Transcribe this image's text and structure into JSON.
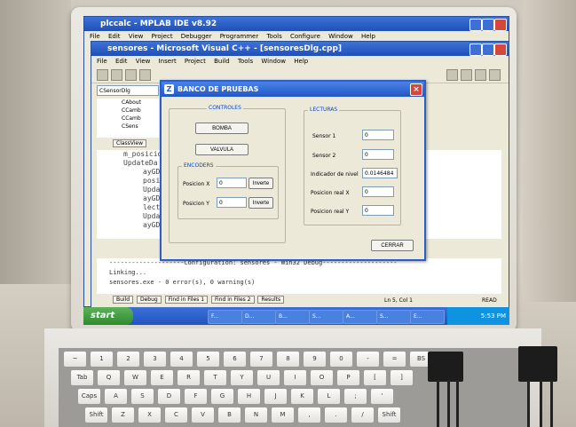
{
  "desktop": {
    "mplab_title": "plccalc - MPLAB IDE v8.92",
    "mplab_menu": [
      "File",
      "Edit",
      "View",
      "Project",
      "Debugger",
      "Programmer",
      "Tools",
      "Configure",
      "Window",
      "Help"
    ],
    "vc_title": "sensores - Microsoft Visual C++ - [sensoresDlg.cpp]",
    "vc_menu": [
      "File",
      "Edit",
      "View",
      "Insert",
      "Project",
      "Build",
      "Tools",
      "Window",
      "Help"
    ],
    "class_combo": "CSensorDlg",
    "tree_items": [
      "CAbout",
      "CCamb",
      "CCamb",
      "CSens"
    ],
    "classview_tab": "ClassView",
    "code_lines": [
      "m_posicion",
      "UpdateDa",
      "ayGD",
      "posi",
      "Upda",
      "ayGD",
      "lect",
      "Upda",
      "ayGD"
    ],
    "output_lines": [
      "Linking...",
      "sensores.exe - 0 error(s), 0 warning(s)"
    ],
    "config_line": "--------------------Configuration: sensores - Win32 Debug--------------------",
    "output_tabs": [
      "Build",
      "Debug",
      "Find in Files 1",
      "Find in Files 2",
      "Results"
    ],
    "status_text": "Ln 5, Col 1",
    "status_read": "READ",
    "start_label": "start",
    "taskbar_items": [
      "F...",
      "D...",
      "B...",
      "S...",
      "A...",
      "S...",
      "E..."
    ],
    "clock": "5:53 PM"
  },
  "dialog": {
    "title": "BANCO DE PRUEBAS",
    "controles_label": "CONTROLES",
    "bomba_button": "BOMBA",
    "valvula_button": "VALVULA",
    "encoders_label": "ENCODERS",
    "pos_x_label": "Posicion X",
    "pos_x_value": "0",
    "invierte_x": "Inverte",
    "pos_y_label": "Posicion Y",
    "pos_y_value": "0",
    "invierte_y": "Inverte",
    "lecturas_label": "LECTURAS",
    "sensor1_label": "Sensor 1",
    "sensor1_value": "0",
    "sensor2_label": "Sensor 2",
    "sensor2_value": "0",
    "nivel_label": "Indicador de nivel",
    "nivel_value": "0.0146484",
    "real_x_label": "Posicion real X",
    "real_x_value": "0",
    "real_y_label": "Posicion real Y",
    "real_y_value": "0",
    "cerrar_button": "CERRAR"
  },
  "keyboard": {
    "row1": [
      "~",
      "1",
      "2",
      "3",
      "4",
      "5",
      "6",
      "7",
      "8",
      "9",
      "0",
      "-",
      "=",
      "BS"
    ],
    "row2": [
      "Tab",
      "Q",
      "W",
      "E",
      "R",
      "T",
      "Y",
      "U",
      "I",
      "O",
      "P",
      "[",
      "]"
    ],
    "row3": [
      "Caps",
      "A",
      "S",
      "D",
      "F",
      "G",
      "H",
      "J",
      "K",
      "L",
      ";",
      "'"
    ],
    "row4": [
      "Shift",
      "Z",
      "X",
      "C",
      "V",
      "B",
      "N",
      "M",
      ",",
      ".",
      "/",
      "Shift"
    ]
  },
  "colors": {
    "xp_titlebar": "#2256c4",
    "xp_start": "#3a9a37",
    "dialog_bg": "#ece9d8",
    "group_label": "#0046d5"
  }
}
